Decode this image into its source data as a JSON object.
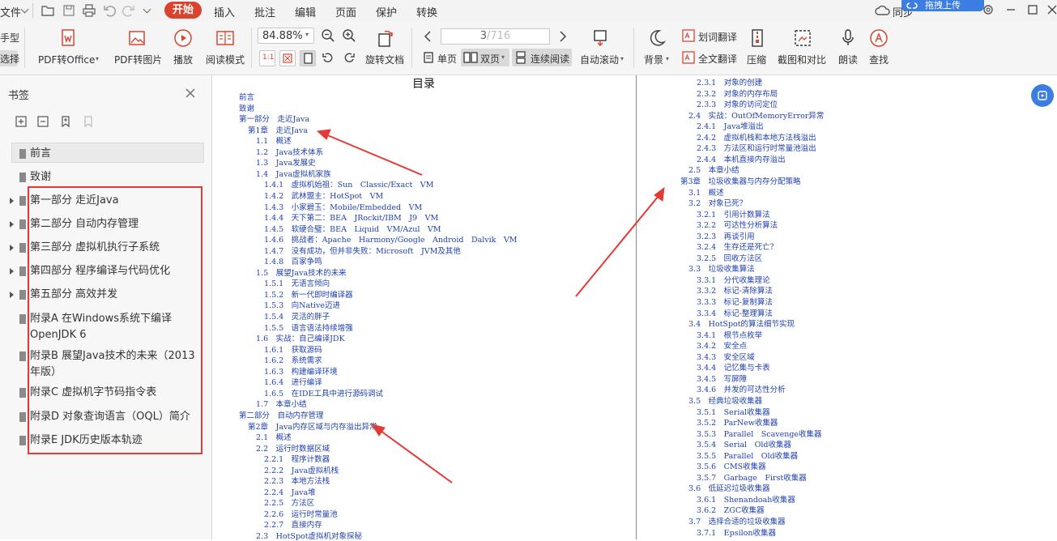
{
  "menu": {
    "file_partial": "文件",
    "tabs": [
      "开始",
      "插入",
      "批注",
      "编辑",
      "页面",
      "保护",
      "转换"
    ],
    "cloud_partial": "同步",
    "cloud_button": "拖拽上传"
  },
  "toolbar": {
    "hand_partial": "手型",
    "select_partial": "选择",
    "pdf_office": "PDF转Office",
    "pdf_image": "PDF转图片",
    "play": "播放",
    "read_mode": "阅读模式",
    "zoom_value": "84.88%",
    "rotate": "旋转文档",
    "page_current": "3",
    "page_total": "/716",
    "single": "单页",
    "double": "双页",
    "continuous": "连续阅读",
    "auto_scroll": "自动滚动",
    "background": "背景",
    "word_translate": "划词翻译",
    "full_translate": "全文翻译",
    "compress": "压缩",
    "screenshot": "截图和对比",
    "read_aloud": "朗读",
    "search": "查找"
  },
  "sidebar": {
    "title": "书签",
    "items": [
      {
        "label": "前言",
        "expand": false
      },
      {
        "label": "致谢",
        "expand": false
      },
      {
        "label": "第一部分 走近Java",
        "expand": true
      },
      {
        "label": "第二部分 自动内存管理",
        "expand": true
      },
      {
        "label": "第三部分 虚拟机执行子系统",
        "expand": true
      },
      {
        "label": "第四部分 程序编译与代码优化",
        "expand": true
      },
      {
        "label": "第五部分 高效并发",
        "expand": true
      },
      {
        "label": "附录A 在Windows系统下编译OpenJDK 6",
        "expand": false
      },
      {
        "label": "附录B 展望Java技术的未来（2013年版）",
        "expand": false
      },
      {
        "label": "附录C 虚拟机字节码指令表",
        "expand": false
      },
      {
        "label": "附录D 对象查询语言（OQL）简介",
        "expand": false
      },
      {
        "label": "附录E JDK历史版本轨迹",
        "expand": false
      }
    ]
  },
  "doc": {
    "title": "目录",
    "left_toc": [
      "前言",
      "致谢",
      "第一部分　走近Java",
      "第1章　走近Java",
      "1.1　概述",
      "1.2　Java技术体系",
      "1.3　Java发展史",
      "1.4　Java虚拟机家族",
      "1.4.1　虚拟机始祖：Sun　Classic/Exact　VM",
      "1.4.2　武林盟主：HotSpot　VM",
      "1.4.3　小家碧玉：Mobile/Embedded　VM",
      "1.4.4　天下第二：BEA　JRockit/IBM　J9　VM",
      "1.4.5　软硬合璧：BEA　Liquid　VM/Azul　VM",
      "1.4.6　挑战者：Apache　Harmony/Google　Android　Dalvik　VM",
      "1.4.7　没有成功，但并非失败：Microsoft　JVM及其他",
      "1.4.8　百家争鸣",
      "1.5　展望Java技术的未来",
      "1.5.1　无语言倾向",
      "1.5.2　新一代即时编译器",
      "1.5.3　向Native迈进",
      "1.5.4　灵活的胖子",
      "1.5.5　语言语法持续增强",
      "1.6　实战：自己编译JDK",
      "1.6.1　获取源码",
      "1.6.2　系统需求",
      "1.6.3　构建编译环境",
      "1.6.4　进行编译",
      "1.6.5　在IDE工具中进行源码调试",
      "1.7　本章小结",
      "第二部分　自动内存管理",
      "第2章　Java内存区域与内存溢出异常",
      "2.1　概述",
      "2.2　运行时数据区域",
      "2.2.1　程序计数器",
      "2.2.2　Java虚拟机栈",
      "2.2.3　本地方法栈",
      "2.2.4　Java堆",
      "2.2.5　方法区",
      "2.2.6　运行时常量池",
      "2.2.7　直接内存",
      "2.3　HotSpot虚拟机对象探秘"
    ],
    "right_toc": [
      "2.3.1　对象的创建",
      "2.3.2　对象的内存布局",
      "2.3.3　对象的访问定位",
      "2.4　实战：OutOfMemoryError异常",
      "2.4.1　Java堆溢出",
      "2.4.2　虚拟机栈和本地方法栈溢出",
      "2.4.3　方法区和运行时常量池溢出",
      "2.4.4　本机直接内存溢出",
      "2.5　本章小结",
      "第3章　垃圾收集器与内存分配策略",
      "3.1　概述",
      "3.2　对象已死？",
      "3.2.1　引用计数算法",
      "3.2.2　可达性分析算法",
      "3.2.3　再谈引用",
      "3.2.4　生存还是死亡？",
      "3.2.5　回收方法区",
      "3.3　垃圾收集算法",
      "3.3.1　分代收集理论",
      "3.3.2　标记-清除算法",
      "3.3.3　标记-复制算法",
      "3.3.4　标记-整理算法",
      "3.4　HotSpot的算法细节实现",
      "3.4.1　根节点枚举",
      "3.4.2　安全点",
      "3.4.3　安全区域",
      "3.4.4　记忆集与卡表",
      "3.4.5　写屏障",
      "3.4.6　并发的可达性分析",
      "3.5　经典垃圾收集器",
      "3.5.1　Serial收集器",
      "3.5.2　ParNew收集器",
      "3.5.3　Parallel　Scavenge收集器",
      "3.5.4　Serial　Old收集器",
      "3.5.5　Parallel　Old收集器",
      "3.5.6　CMS收集器",
      "3.5.7　Garbage　First收集器",
      "3.6　低延迟垃圾收集器",
      "3.6.1　Shenandoah收集器",
      "3.6.2　ZGC收集器",
      "3.7　选择合适的垃圾收集器",
      "3.7.1　Epsilon收集器"
    ]
  }
}
